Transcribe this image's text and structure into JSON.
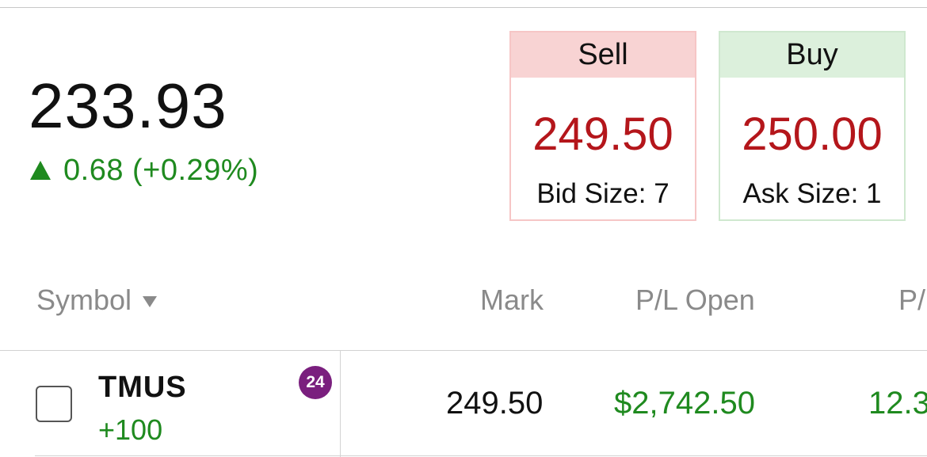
{
  "quote": {
    "last": "233.93",
    "change": "0.68 (+0.29%)",
    "change_direction": "up",
    "up_color": "#1f8a1f"
  },
  "sell": {
    "label": "Sell",
    "price": "249.50",
    "size": "Bid Size: 7",
    "header_color": "#f8d3d3"
  },
  "buy": {
    "label": "Buy",
    "price": "250.00",
    "size": "Ask Size: 1",
    "header_color": "#dcf0dc"
  },
  "price_color": "#b4161b",
  "table": {
    "columns": {
      "symbol": "Symbol",
      "mark": "Mark",
      "pl_open": "P/L Open",
      "pl_day": "P/"
    },
    "sort_icon": "sort-down-icon",
    "rows": [
      {
        "symbol": "TMUS",
        "quantity": "+100",
        "badge": "24",
        "mark": "249.50",
        "pl_open": "$2,742.50",
        "pl_day": "12.3"
      }
    ]
  }
}
